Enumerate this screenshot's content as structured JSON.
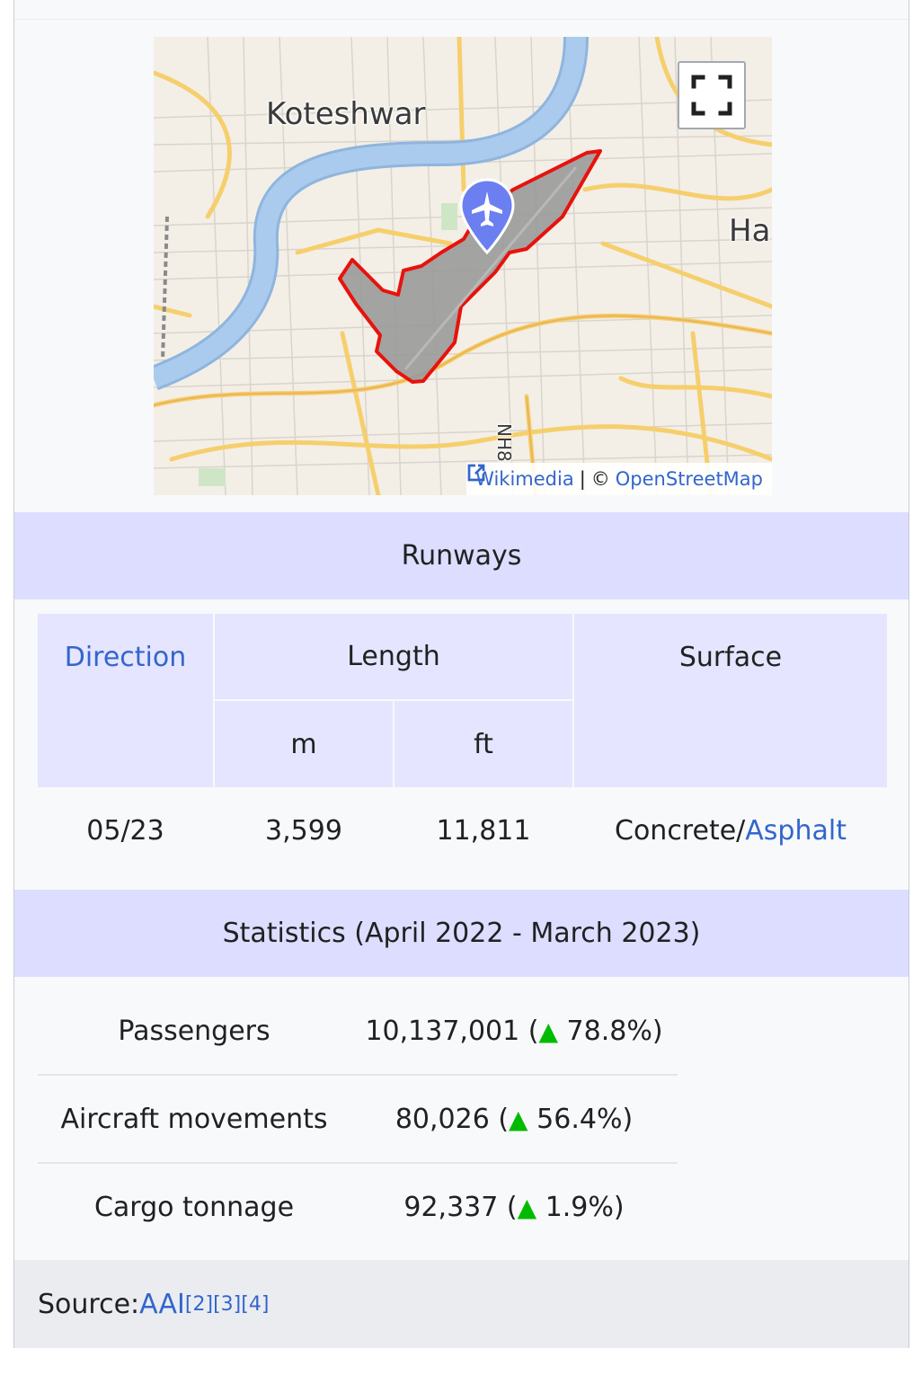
{
  "map": {
    "labels": {
      "koteshwar": "Koteshwar",
      "ha": "Ha",
      "nh8": "NH8"
    },
    "attribution": {
      "wikimedia": "Wikimedia",
      "separator": "|",
      "copyright": "©",
      "osm": "OpenStreetMap"
    },
    "icons": [
      "fullscreen-icon",
      "airport-marker-icon",
      "external-link-icon"
    ]
  },
  "runways": {
    "title": "Runways",
    "headers": {
      "direction": "Direction",
      "length": "Length",
      "m": "m",
      "ft": "ft",
      "surface": "Surface"
    },
    "row": {
      "direction": "05/23",
      "m": "3,599",
      "ft": "11,811",
      "surface_a": "Concrete/",
      "surface_b": "Asphalt"
    }
  },
  "statistics": {
    "title": "Statistics (April 2022 - March 2023)",
    "rows": [
      {
        "label": "Passengers",
        "value": "10,137,001 (",
        "change": "78.8%)"
      },
      {
        "label": "Aircraft movements",
        "value": "80,026 (",
        "change": "56.4%)"
      },
      {
        "label": "Cargo tonnage",
        "value": "92,337 (",
        "change": "1.9%)"
      }
    ],
    "increase_symbol": "▲"
  },
  "source": {
    "label": "Source: ",
    "link": "AAI",
    "refs": [
      "[2]",
      "[3]",
      "[4]"
    ]
  },
  "colors": {
    "header_bg": "#ddddff",
    "link": "#3366cc",
    "increase": "#00bb00",
    "airport_outline": "#e8120c"
  }
}
